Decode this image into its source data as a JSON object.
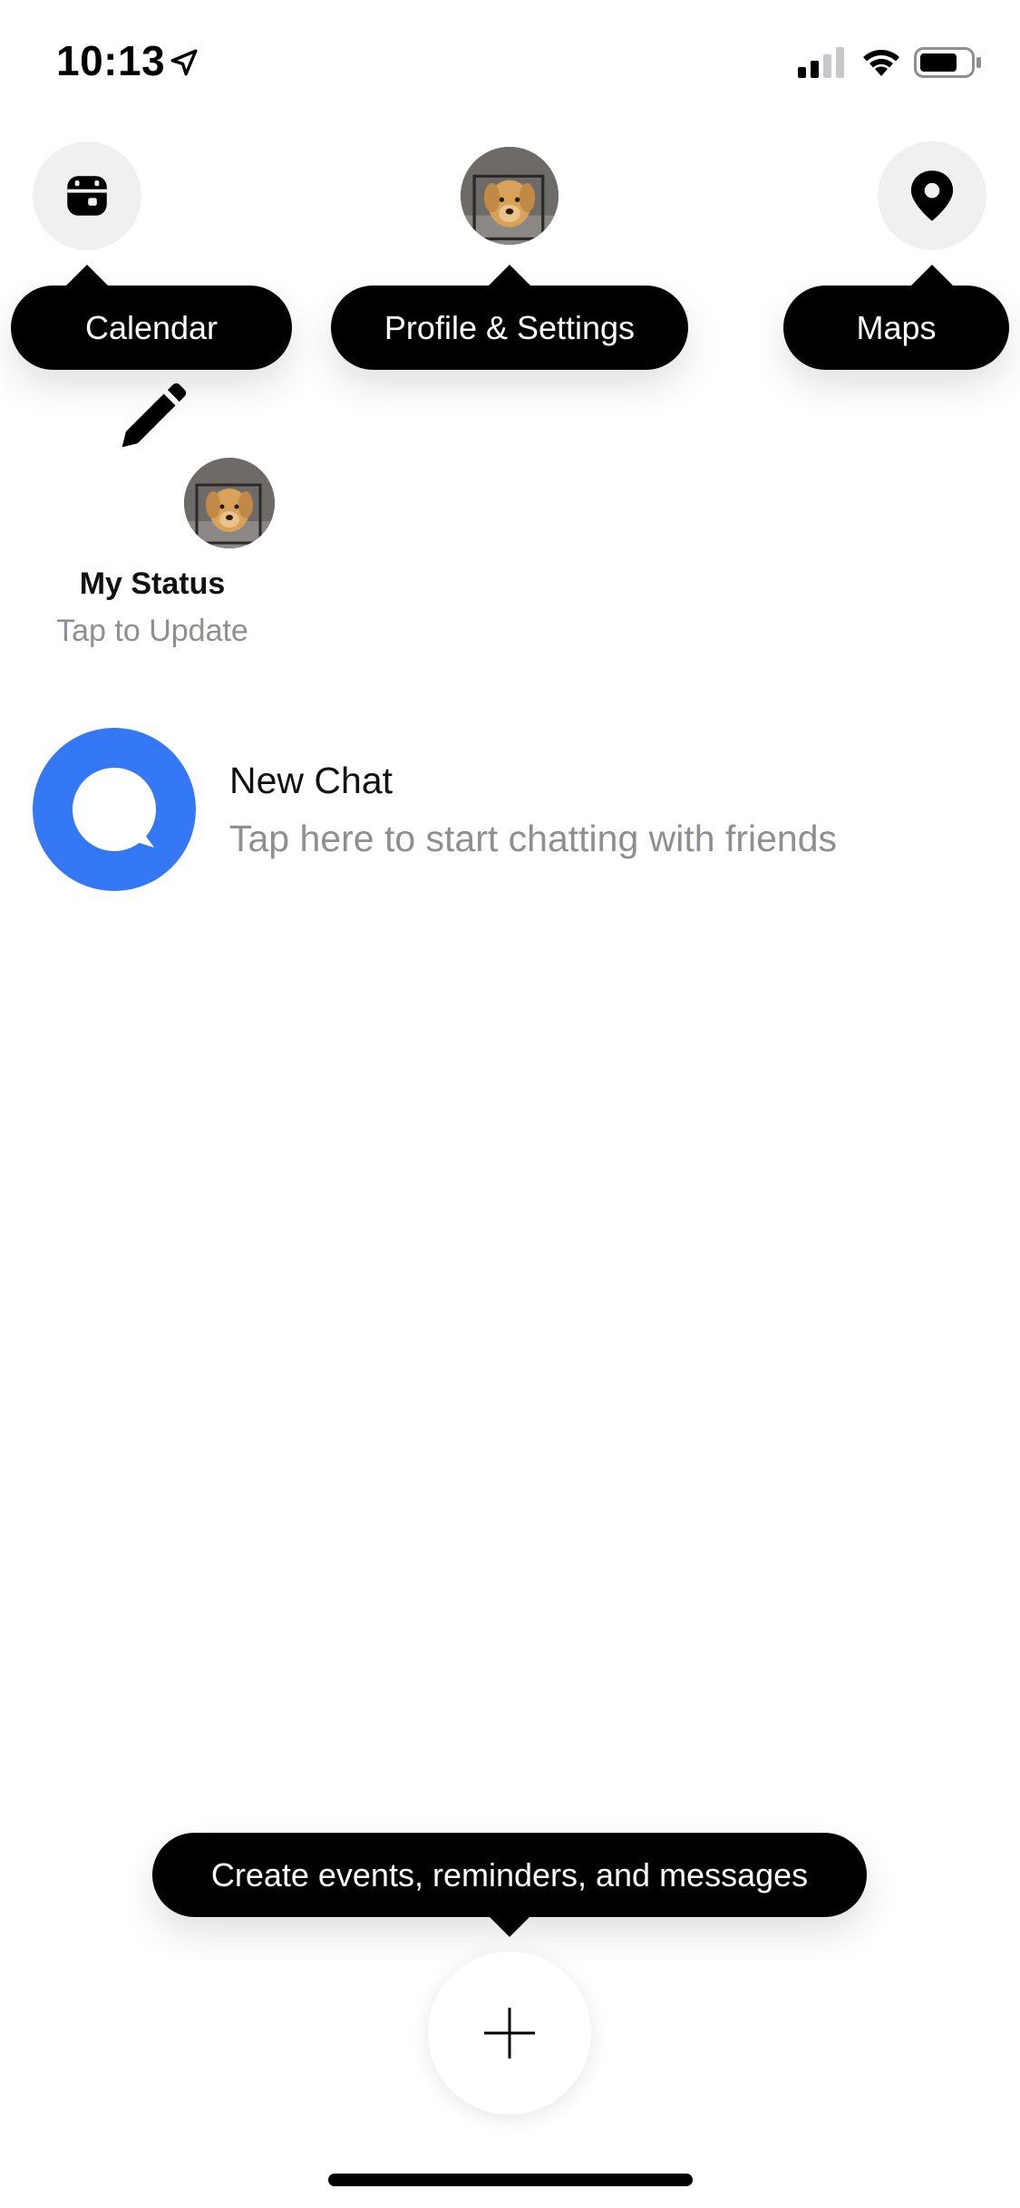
{
  "status_bar": {
    "time": "10:13",
    "icons": [
      "location-arrow-icon",
      "cellular-signal-icon",
      "wifi-icon",
      "battery-icon"
    ]
  },
  "header": {
    "calendar_icon": "calendar-icon",
    "profile_icon": "profile-avatar",
    "maps_icon": "map-pin-icon"
  },
  "tooltips": {
    "calendar": "Calendar",
    "profile": "Profile & Settings",
    "maps": "Maps",
    "create": "Create events, reminders, and messages"
  },
  "my_status": {
    "title": "My Status",
    "subtitle": "Tap to Update",
    "icon": "pencil-icon"
  },
  "new_chat": {
    "title": "New Chat",
    "subtitle": "Tap here to start chatting with friends",
    "icon": "chat-bubble-icon"
  },
  "fab": {
    "icon": "plus-icon"
  },
  "colors": {
    "accent": "#3478F6",
    "circle_bg": "#F0F0F0",
    "secondary_text": "#8E8E93",
    "tooltip_bg": "#000000"
  }
}
